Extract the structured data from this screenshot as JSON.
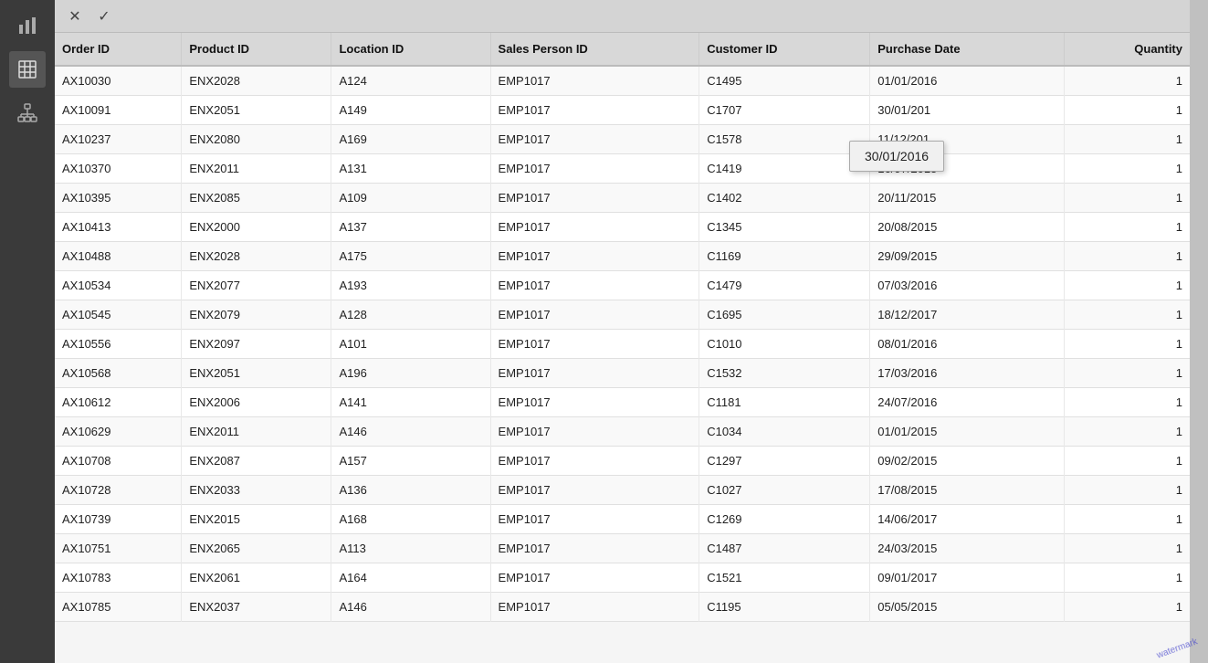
{
  "toolbar": {
    "cancel_label": "✕",
    "confirm_label": "✓"
  },
  "sidebar": {
    "icons": [
      {
        "name": "bar-chart-icon",
        "symbol": "▮▮",
        "label": "Bar Chart"
      },
      {
        "name": "table-icon",
        "symbol": "⊞",
        "label": "Table"
      },
      {
        "name": "hierarchy-icon",
        "symbol": "❖",
        "label": "Hierarchy"
      }
    ]
  },
  "table": {
    "columns": [
      {
        "key": "order_id",
        "label": "Order ID"
      },
      {
        "key": "product_id",
        "label": "Product ID"
      },
      {
        "key": "location_id",
        "label": "Location ID"
      },
      {
        "key": "sales_person_id",
        "label": "Sales Person ID"
      },
      {
        "key": "customer_id",
        "label": "Customer ID"
      },
      {
        "key": "purchase_date",
        "label": "Purchase Date"
      },
      {
        "key": "quantity",
        "label": "Quantity"
      }
    ],
    "rows": [
      {
        "order_id": "AX10030",
        "product_id": "ENX2028",
        "location_id": "A124",
        "sales_person_id": "EMP1017",
        "customer_id": "C1495",
        "purchase_date": "01/01/2016",
        "quantity": "1"
      },
      {
        "order_id": "AX10091",
        "product_id": "ENX2051",
        "location_id": "A149",
        "sales_person_id": "EMP1017",
        "customer_id": "C1707",
        "purchase_date": "30/01/201",
        "quantity": "1"
      },
      {
        "order_id": "AX10237",
        "product_id": "ENX2080",
        "location_id": "A169",
        "sales_person_id": "EMP1017",
        "customer_id": "C1578",
        "purchase_date": "11/12/201",
        "quantity": "1"
      },
      {
        "order_id": "AX10370",
        "product_id": "ENX2011",
        "location_id": "A131",
        "sales_person_id": "EMP1017",
        "customer_id": "C1419",
        "purchase_date": "16/07/2015",
        "quantity": "1"
      },
      {
        "order_id": "AX10395",
        "product_id": "ENX2085",
        "location_id": "A109",
        "sales_person_id": "EMP1017",
        "customer_id": "C1402",
        "purchase_date": "20/11/2015",
        "quantity": "1"
      },
      {
        "order_id": "AX10413",
        "product_id": "ENX2000",
        "location_id": "A137",
        "sales_person_id": "EMP1017",
        "customer_id": "C1345",
        "purchase_date": "20/08/2015",
        "quantity": "1"
      },
      {
        "order_id": "AX10488",
        "product_id": "ENX2028",
        "location_id": "A175",
        "sales_person_id": "EMP1017",
        "customer_id": "C1169",
        "purchase_date": "29/09/2015",
        "quantity": "1"
      },
      {
        "order_id": "AX10534",
        "product_id": "ENX2077",
        "location_id": "A193",
        "sales_person_id": "EMP1017",
        "customer_id": "C1479",
        "purchase_date": "07/03/2016",
        "quantity": "1"
      },
      {
        "order_id": "AX10545",
        "product_id": "ENX2079",
        "location_id": "A128",
        "sales_person_id": "EMP1017",
        "customer_id": "C1695",
        "purchase_date": "18/12/2017",
        "quantity": "1"
      },
      {
        "order_id": "AX10556",
        "product_id": "ENX2097",
        "location_id": "A101",
        "sales_person_id": "EMP1017",
        "customer_id": "C1010",
        "purchase_date": "08/01/2016",
        "quantity": "1"
      },
      {
        "order_id": "AX10568",
        "product_id": "ENX2051",
        "location_id": "A196",
        "sales_person_id": "EMP1017",
        "customer_id": "C1532",
        "purchase_date": "17/03/2016",
        "quantity": "1"
      },
      {
        "order_id": "AX10612",
        "product_id": "ENX2006",
        "location_id": "A141",
        "sales_person_id": "EMP1017",
        "customer_id": "C1181",
        "purchase_date": "24/07/2016",
        "quantity": "1"
      },
      {
        "order_id": "AX10629",
        "product_id": "ENX2011",
        "location_id": "A146",
        "sales_person_id": "EMP1017",
        "customer_id": "C1034",
        "purchase_date": "01/01/2015",
        "quantity": "1"
      },
      {
        "order_id": "AX10708",
        "product_id": "ENX2087",
        "location_id": "A157",
        "sales_person_id": "EMP1017",
        "customer_id": "C1297",
        "purchase_date": "09/02/2015",
        "quantity": "1"
      },
      {
        "order_id": "AX10728",
        "product_id": "ENX2033",
        "location_id": "A136",
        "sales_person_id": "EMP1017",
        "customer_id": "C1027",
        "purchase_date": "17/08/2015",
        "quantity": "1"
      },
      {
        "order_id": "AX10739",
        "product_id": "ENX2015",
        "location_id": "A168",
        "sales_person_id": "EMP1017",
        "customer_id": "C1269",
        "purchase_date": "14/06/2017",
        "quantity": "1"
      },
      {
        "order_id": "AX10751",
        "product_id": "ENX2065",
        "location_id": "A113",
        "sales_person_id": "EMP1017",
        "customer_id": "C1487",
        "purchase_date": "24/03/2015",
        "quantity": "1"
      },
      {
        "order_id": "AX10783",
        "product_id": "ENX2061",
        "location_id": "A164",
        "sales_person_id": "EMP1017",
        "customer_id": "C1521",
        "purchase_date": "09/01/2017",
        "quantity": "1"
      },
      {
        "order_id": "AX10785",
        "product_id": "ENX2037",
        "location_id": "A146",
        "sales_person_id": "EMP1017",
        "customer_id": "C1195",
        "purchase_date": "05/05/2015",
        "quantity": "1"
      }
    ]
  },
  "tooltip": {
    "text": "30/01/2016",
    "visible": true
  }
}
